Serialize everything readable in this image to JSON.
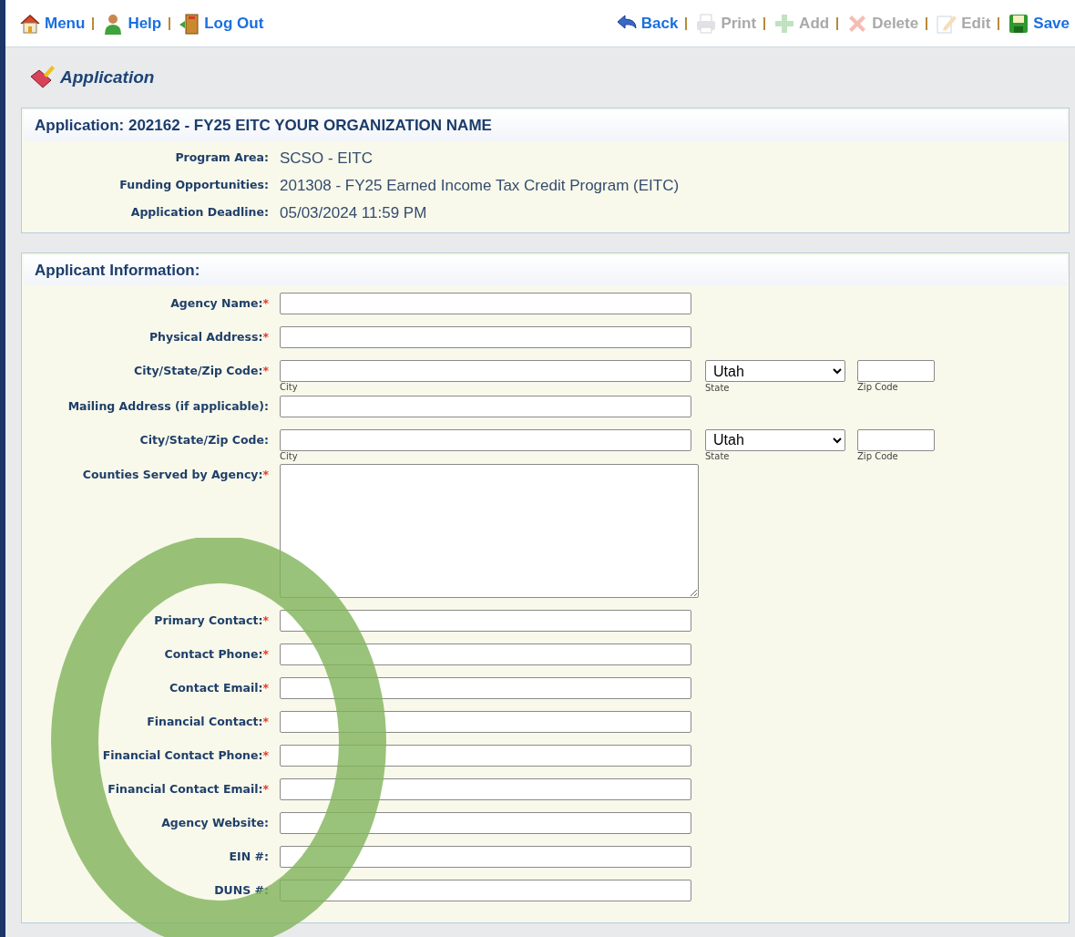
{
  "toolbar_left": [
    {
      "label": "Menu",
      "disabled": false
    },
    {
      "label": "Help",
      "disabled": false
    },
    {
      "label": "Log Out",
      "disabled": false
    }
  ],
  "toolbar_right": [
    {
      "label": "Back",
      "disabled": false
    },
    {
      "label": "Print",
      "disabled": true
    },
    {
      "label": "Add",
      "disabled": true
    },
    {
      "label": "Delete",
      "disabled": true
    },
    {
      "label": "Edit",
      "disabled": true
    },
    {
      "label": "Save",
      "disabled": false
    }
  ],
  "page_title": "Application",
  "summary": {
    "title": "Application: 202162 - FY25 EITC YOUR ORGANIZATION NAME",
    "rows": [
      {
        "label": "Program Area:",
        "value": "SCSO - EITC"
      },
      {
        "label": "Funding Opportunities:",
        "value": "201308 - FY25 Earned Income Tax Credit Program (EITC)"
      },
      {
        "label": "Application Deadline:",
        "value": "05/03/2024 11:59 PM"
      }
    ]
  },
  "applicant": {
    "title": "Applicant Information:",
    "fields": [
      {
        "kind": "text",
        "label": "Agency Name:",
        "required_mark": "*"
      },
      {
        "kind": "text",
        "label": "Physical Address:",
        "required_mark": "*"
      },
      {
        "kind": "address",
        "label": "City/State/Zip Code:",
        "required_mark": "*",
        "city_caption": "City",
        "state_value": "Utah",
        "state_caption": "State",
        "zip_caption": "Zip Code"
      },
      {
        "kind": "text",
        "label": "Mailing Address (if applicable):"
      },
      {
        "kind": "address",
        "label": "City/State/Zip Code:",
        "city_caption": "City",
        "state_value": "Utah",
        "state_caption": "State",
        "zip_caption": "Zip Code"
      },
      {
        "kind": "textarea",
        "label": "Counties Served by Agency:",
        "required_mark": "*"
      },
      {
        "kind": "text",
        "label": "Primary Contact:",
        "required_mark": "*"
      },
      {
        "kind": "text",
        "label": "Contact Phone:",
        "required_mark": "*"
      },
      {
        "kind": "text",
        "label": "Contact Email:",
        "required_mark": "*"
      },
      {
        "kind": "text",
        "label": "Financial Contact:",
        "required_mark": "*"
      },
      {
        "kind": "text",
        "label": "Financial Contact Phone:",
        "required_mark": "*"
      },
      {
        "kind": "text",
        "label": "Financial Contact Email:",
        "required_mark": "*"
      },
      {
        "kind": "text",
        "label": "Agency Website:"
      },
      {
        "kind": "text",
        "label": "EIN #:"
      },
      {
        "kind": "text",
        "label": "DUNS #:"
      }
    ]
  },
  "annotation": {
    "kind": "ellipse"
  }
}
